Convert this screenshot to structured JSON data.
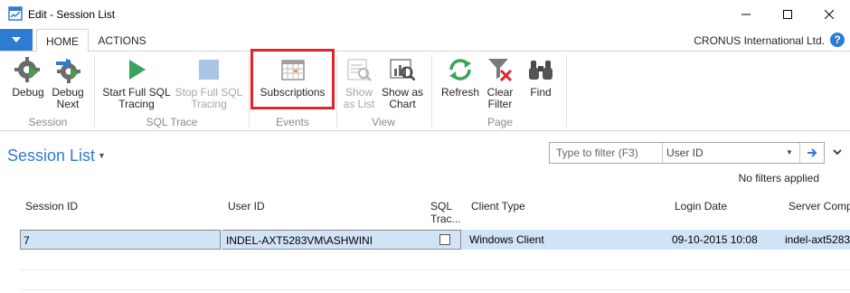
{
  "window": {
    "title": "Edit - Session List",
    "minimize_icon": "minimize-icon",
    "maximize_icon": "maximize-icon",
    "close_icon": "close-icon"
  },
  "ribbon_tabs": [
    {
      "label": "HOME",
      "active": true
    },
    {
      "label": "ACTIONS",
      "active": false
    }
  ],
  "company": "CRONUS International Ltd.",
  "help_label": "?",
  "ribbon": {
    "groups": [
      {
        "label": "Session",
        "buttons": [
          {
            "label_lines": [
              "Debug"
            ],
            "icon": "gear-debug-icon",
            "enabled": true
          },
          {
            "label_lines": [
              "Debug",
              "Next"
            ],
            "icon": "gear-debug-next-icon",
            "enabled": true
          }
        ]
      },
      {
        "label": "SQL Trace",
        "buttons": [
          {
            "label_lines": [
              "Start Full SQL",
              "Tracing"
            ],
            "icon": "play-icon",
            "enabled": true
          },
          {
            "label_lines": [
              "Stop Full SQL",
              "Tracing"
            ],
            "icon": "stop-icon",
            "enabled": false
          }
        ]
      },
      {
        "label": "Events",
        "buttons": [
          {
            "label_lines": [
              "Subscriptions"
            ],
            "icon": "calendar-grid-icon",
            "enabled": true,
            "highlighted": true
          }
        ]
      },
      {
        "label": "View",
        "buttons": [
          {
            "label_lines": [
              "Show",
              "as List"
            ],
            "icon": "list-view-icon",
            "enabled": false
          },
          {
            "label_lines": [
              "Show as",
              "Chart"
            ],
            "icon": "chart-view-icon",
            "enabled": true
          }
        ]
      },
      {
        "label": "Page",
        "buttons": [
          {
            "label_lines": [
              "Refresh"
            ],
            "icon": "refresh-icon",
            "enabled": true
          },
          {
            "label_lines": [
              "Clear",
              "Filter"
            ],
            "icon": "clear-filter-icon",
            "enabled": true
          },
          {
            "label_lines": [
              "Find"
            ],
            "icon": "binoculars-icon",
            "enabled": true
          }
        ]
      }
    ]
  },
  "page": {
    "title": "Session List",
    "title_caret": "▼",
    "filter_placeholder": "Type to filter (F3)",
    "filter_field": "User ID",
    "filter_status": "No filters applied"
  },
  "grid": {
    "columns": [
      "Session ID",
      "User ID",
      "SQL Trac...",
      "Client Type",
      "Login Date",
      "Server Comp"
    ],
    "rows": [
      {
        "session_id": "7",
        "user_id": "INDEL-AXT5283VM\\ASHWINI",
        "sql_tracing": false,
        "client_type": "Windows Client",
        "login_date": "09-10-2015 10:08",
        "server_computer": "indel-axt5283"
      }
    ]
  },
  "colors": {
    "accent": "#2d7bd3",
    "highlight_border": "#e0252b",
    "selected_row": "#d1e4f7",
    "disabled_text": "#a6a6a6"
  }
}
